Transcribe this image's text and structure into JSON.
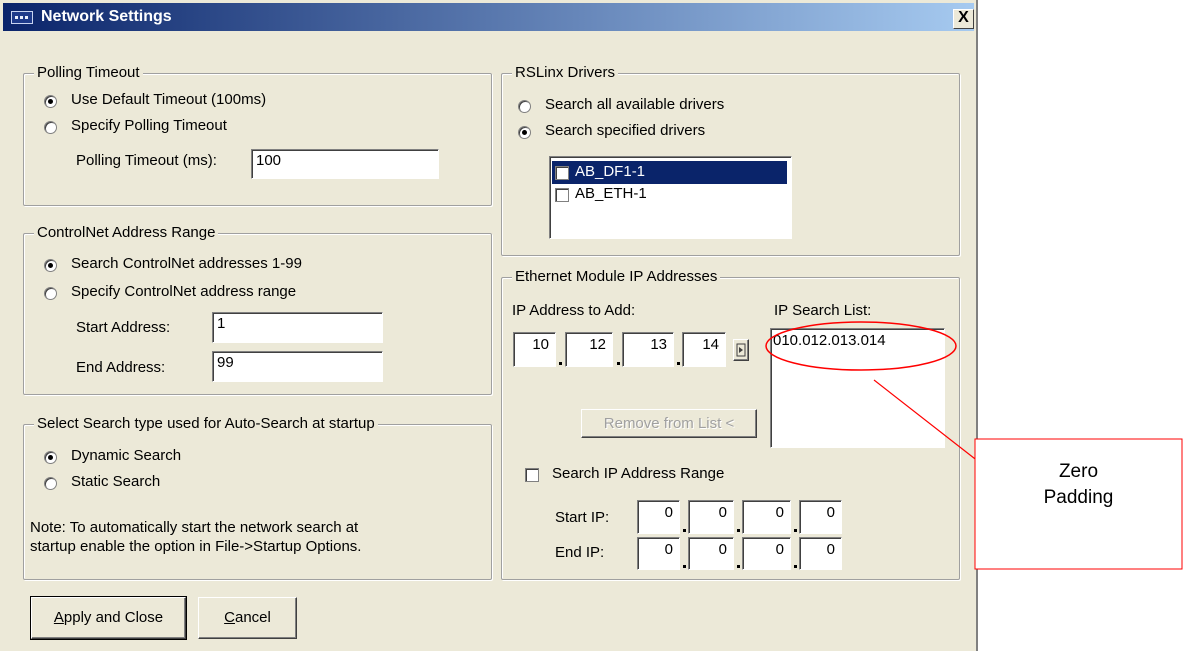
{
  "window": {
    "title": "Network Settings",
    "close_glyph": "X"
  },
  "polling": {
    "legend": "Polling Timeout",
    "opt_default": "Use Default Timeout (100ms)",
    "opt_specify": "Specify Polling Timeout",
    "timeout_label": "Polling Timeout (ms):",
    "timeout_value": "100",
    "selected": "default"
  },
  "controlnet": {
    "legend": "ControlNet Address Range",
    "opt_default": "Search ControlNet addresses 1-99",
    "opt_specify": "Specify ControlNet address range",
    "start_label": "Start Address:",
    "start_value": "1",
    "end_label": "End Address:",
    "end_value": "99",
    "selected": "default"
  },
  "search_type": {
    "legend": "Select Search type used for Auto-Search at startup",
    "opt_dynamic": "Dynamic Search",
    "opt_static": "Static Search",
    "note_line1": "Note: To automatically start the network search at",
    "note_line2": "startup enable the option in File->Startup Options.",
    "selected": "dynamic"
  },
  "rslinx": {
    "legend": "RSLinx Drivers",
    "opt_all": "Search all available drivers",
    "opt_specified": "Search specified drivers",
    "selected": "specified",
    "drivers": [
      {
        "name": "AB_DF1-1",
        "checked": false,
        "highlighted": true
      },
      {
        "name": "AB_ETH-1",
        "checked": false,
        "highlighted": false
      }
    ]
  },
  "ethernet": {
    "legend": "Ethernet Module IP Addresses",
    "add_label": "IP Address to Add:",
    "list_label": "IP Search List:",
    "ip_to_add": [
      "10",
      "12",
      "13",
      "14"
    ],
    "search_list": [
      "010.012.013.014"
    ],
    "remove_button": "Remove from List <",
    "range_checkbox_label": "Search IP Address Range",
    "range_checked": false,
    "start_ip_label": "Start IP:",
    "start_ip": [
      "0",
      "0",
      "0",
      "0"
    ],
    "end_ip_label": "End IP:",
    "end_ip": [
      "0",
      "0",
      "0",
      "0"
    ]
  },
  "buttons": {
    "apply_prefix": "A",
    "apply_rest": "pply and Close",
    "cancel_prefix": "C",
    "cancel_rest": "ancel"
  },
  "annotation": {
    "line1": "Zero",
    "line2": "Padding",
    "color": "#ff0000"
  },
  "colors": {
    "title_start": "#0a246a",
    "title_end": "#a6caf0",
    "dialog_bg": "#ece9d8",
    "selection": "#0a246a"
  }
}
